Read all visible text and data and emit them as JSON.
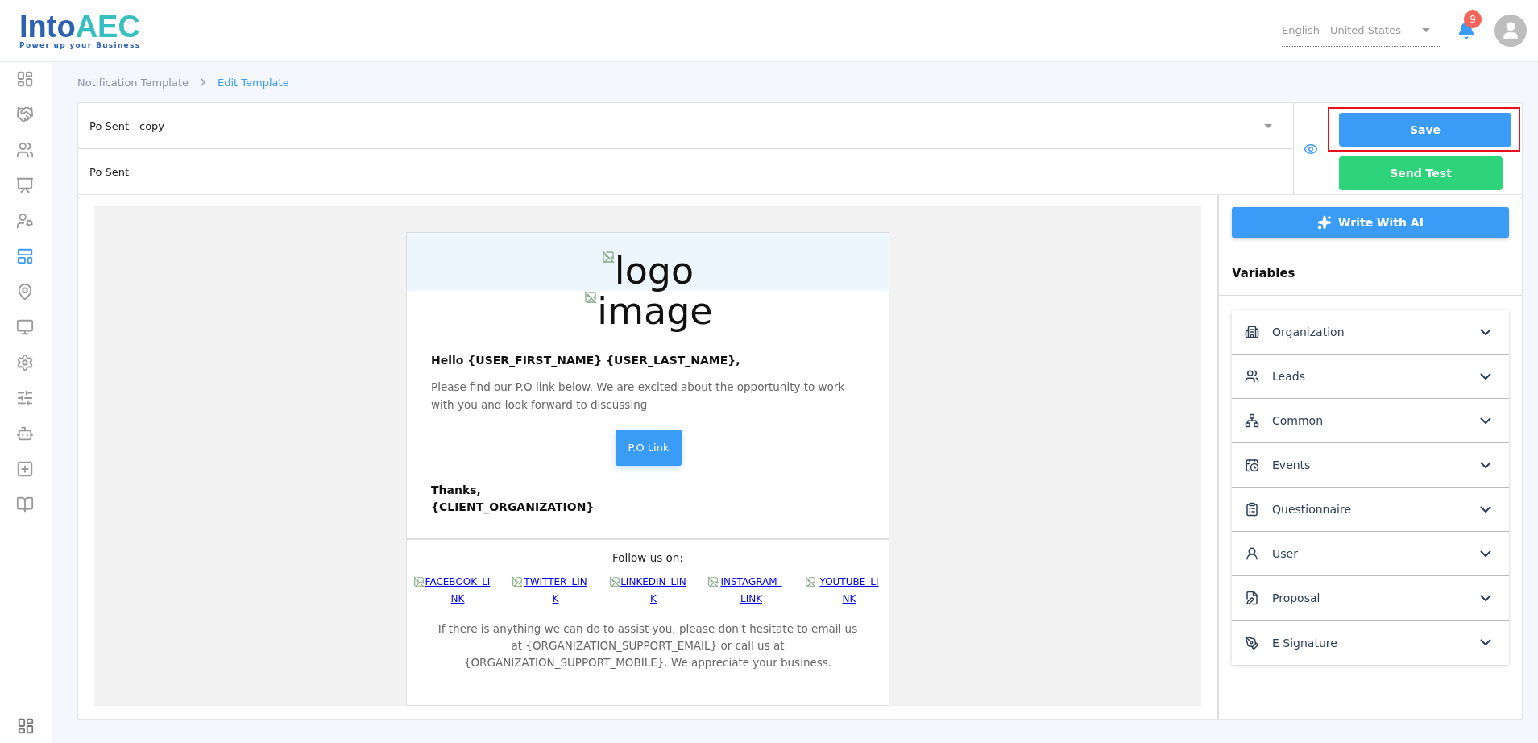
{
  "header": {
    "logo": {
      "main": "Into",
      "accent": "AEC",
      "tagline": "Power up your Business"
    },
    "language": "English - United States",
    "notifications": "9"
  },
  "sidebar": {
    "items": [
      {
        "selected": false
      },
      {
        "selected": false
      },
      {
        "selected": false
      },
      {
        "selected": false
      },
      {
        "selected": false
      },
      {
        "selected": true
      },
      {
        "selected": false
      },
      {
        "selected": false
      },
      {
        "selected": false
      },
      {
        "selected": false
      },
      {
        "selected": false
      },
      {
        "selected": false
      },
      {
        "selected": false
      }
    ]
  },
  "breadcrumb": [
    {
      "label": "Notification Template",
      "selected": false
    },
    {
      "label": "Edit Template",
      "selected": true
    }
  ],
  "form": {
    "name": "Po Sent - copy",
    "subject": "Po Sent"
  },
  "actions": [
    {
      "kind": "save",
      "label": "Save",
      "highlighted": true
    },
    {
      "kind": "test",
      "label": "Send Test",
      "highlighted": false
    }
  ],
  "email": {
    "logo_alt": "logo",
    "image_alt": "image",
    "greeting": "Hello {USER_FIRST_NAME} {USER_LAST_NAME},",
    "body": "Please find our P.O link below. We are excited about the opportunity to work with you and look forward to discussing",
    "button": "P.O Link",
    "thanks": "Thanks,",
    "signature": "{CLIENT_ORGANIZATION}",
    "follow": "Follow us on:",
    "social": [
      "FACEBOOK_LINK",
      "TWITTER_LINK",
      "LINKEDIN_LINK",
      "INSTAGRAM_LINK",
      "YOUTUBE_LINK"
    ],
    "footer": "If there is anything we can do to assist you, please don't hesitate to email us at {ORGANIZATION_SUPPORT_EMAIL} or call us at {ORGANIZATION_SUPPORT_MOBILE}. We appreciate your business."
  },
  "panel": {
    "ai_button": "Write With AI",
    "title": "Variables",
    "groups": [
      {
        "label": "Organization",
        "expanded": false
      },
      {
        "label": "Leads",
        "expanded": false
      },
      {
        "label": "Common",
        "expanded": false
      },
      {
        "label": "Events",
        "expanded": false
      },
      {
        "label": "Questionnaire",
        "expanded": false
      },
      {
        "label": "User",
        "expanded": false
      },
      {
        "label": "Proposal",
        "expanded": false
      },
      {
        "label": "E Signature",
        "expanded": false
      }
    ]
  }
}
